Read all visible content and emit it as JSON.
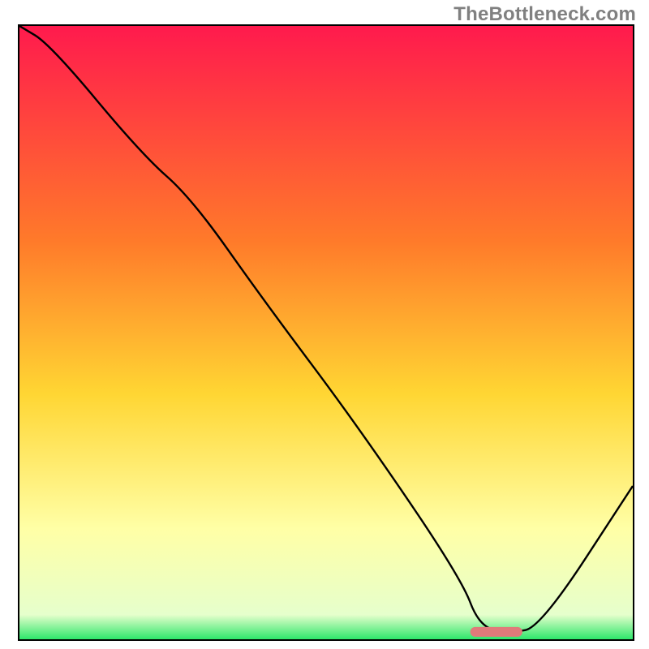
{
  "watermark": "TheBottleneck.com",
  "chart_data": {
    "type": "line",
    "title": "",
    "xlabel": "",
    "ylabel": "",
    "xlim": [
      0,
      100
    ],
    "ylim": [
      0,
      100
    ],
    "gradient_stops": [
      {
        "pos": 0,
        "color": "#ff1a4d"
      },
      {
        "pos": 0.35,
        "color": "#ff7a2a"
      },
      {
        "pos": 0.6,
        "color": "#ffd633"
      },
      {
        "pos": 0.82,
        "color": "#ffffa6"
      },
      {
        "pos": 0.96,
        "color": "#e6ffcc"
      },
      {
        "pos": 1.0,
        "color": "#2ee66b"
      }
    ],
    "curve": {
      "x": [
        0,
        5,
        20,
        28,
        40,
        55,
        72,
        75,
        80,
        85,
        100
      ],
      "y": [
        100,
        97,
        79,
        72,
        55,
        35,
        10,
        2,
        1,
        2,
        25
      ]
    },
    "marker": {
      "x_start": 73.5,
      "x_end": 82,
      "y": 1.2,
      "color": "#e07a7a"
    }
  }
}
